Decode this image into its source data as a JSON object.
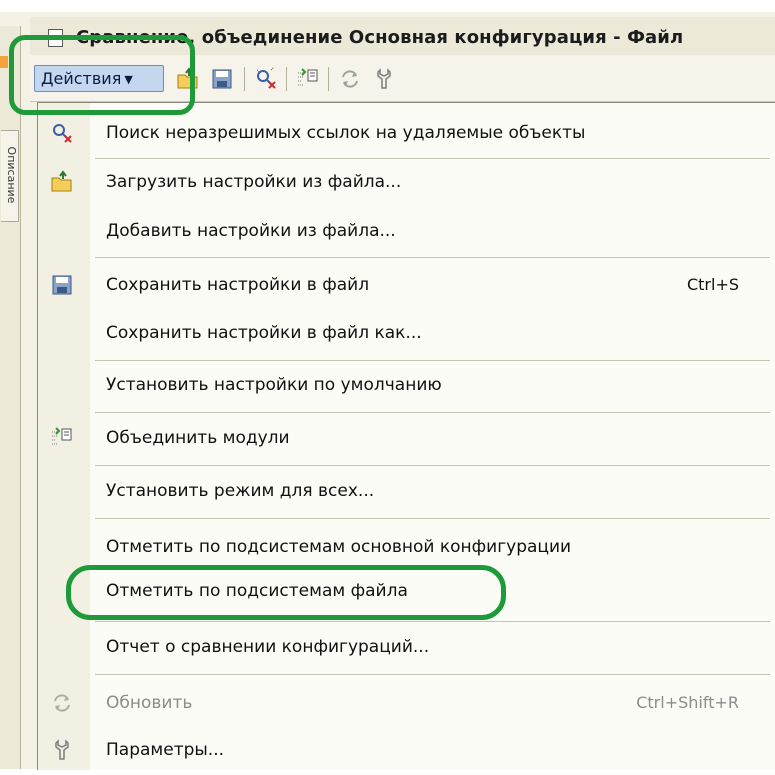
{
  "window": {
    "title": "Сравнение, объединение Основная конфигурация - Файл",
    "side_tab_label": "Описание"
  },
  "toolbar": {
    "actions_label": "Действия",
    "icons": [
      "load-settings-icon",
      "save-icon",
      "find-unresolved-links-icon",
      "merge-modules-icon",
      "refresh-icon",
      "parameters-wrench-icon"
    ]
  },
  "menu": {
    "items": [
      {
        "label": "Поиск неразрешимых ссылок на удаляемые объекты",
        "icon": "find-unresolved-links-icon",
        "shortcut": ""
      },
      {
        "label": "Загрузить настройки из файла...",
        "icon": "load-settings-icon",
        "shortcut": ""
      },
      {
        "label": "Добавить настройки из файла...",
        "icon": "",
        "shortcut": ""
      },
      {
        "label": "Сохранить настройки в файл",
        "icon": "save-icon",
        "shortcut": "Ctrl+S"
      },
      {
        "label": "Сохранить настройки в файл как...",
        "icon": "",
        "shortcut": ""
      },
      {
        "label": "Установить настройки по умолчанию",
        "icon": "",
        "shortcut": ""
      },
      {
        "label": "Объединить модули",
        "icon": "merge-modules-icon",
        "shortcut": ""
      },
      {
        "label": "Установить режим для всех...",
        "icon": "",
        "shortcut": ""
      },
      {
        "label": "Отметить по подсистемам основной конфигурации",
        "icon": "",
        "shortcut": ""
      },
      {
        "label": "Отметить по подсистемам файла",
        "icon": "",
        "shortcut": "",
        "highlighted": true
      },
      {
        "label": "Отчет о сравнении конфигураций...",
        "icon": "",
        "shortcut": ""
      },
      {
        "label": "Обновить",
        "icon": "refresh-icon",
        "shortcut": "Ctrl+Shift+R",
        "disabled": true
      },
      {
        "label": "Параметры...",
        "icon": "parameters-wrench-icon",
        "shortcut": ""
      }
    ]
  },
  "colors": {
    "highlight_ring": "#1f9a3a",
    "actions_button_bg": "#c5d6ef",
    "menu_bg": "#fcfcf7",
    "disabled_text": "#8b8b8b"
  }
}
